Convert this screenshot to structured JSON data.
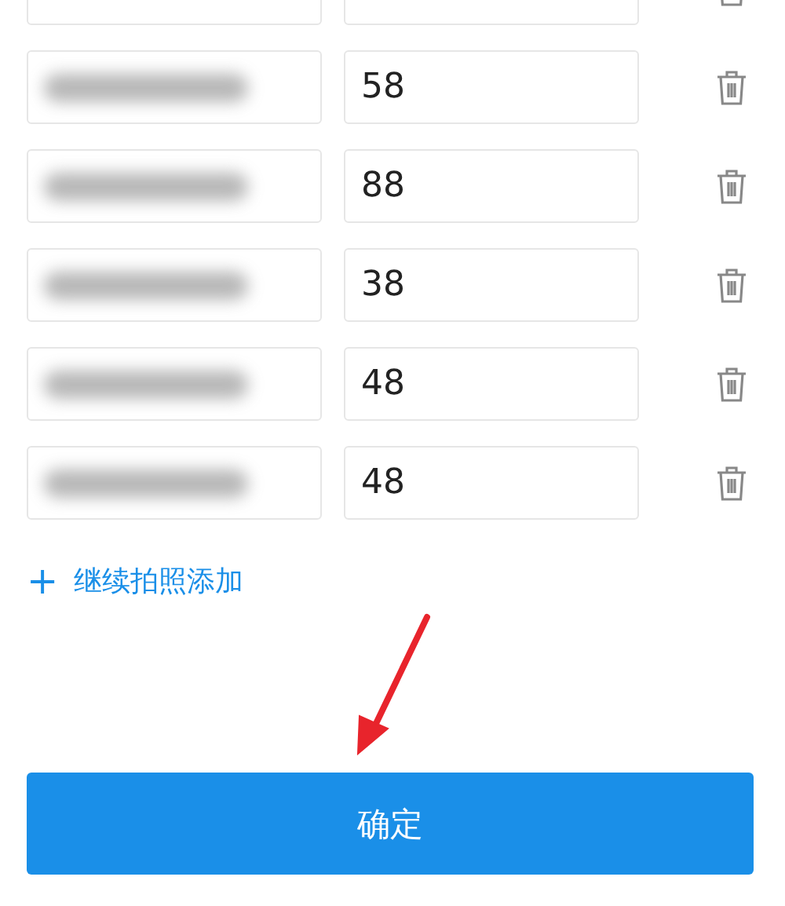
{
  "items": [
    {
      "kind": "cut"
    },
    {
      "kind": "full",
      "price": "58"
    },
    {
      "kind": "full",
      "price": "88"
    },
    {
      "kind": "full",
      "price": "38"
    },
    {
      "kind": "full",
      "price": "48"
    },
    {
      "kind": "full",
      "price": "48"
    }
  ],
  "add_link": {
    "icon": "+",
    "label": "继续拍照添加"
  },
  "confirm_button": "确定"
}
